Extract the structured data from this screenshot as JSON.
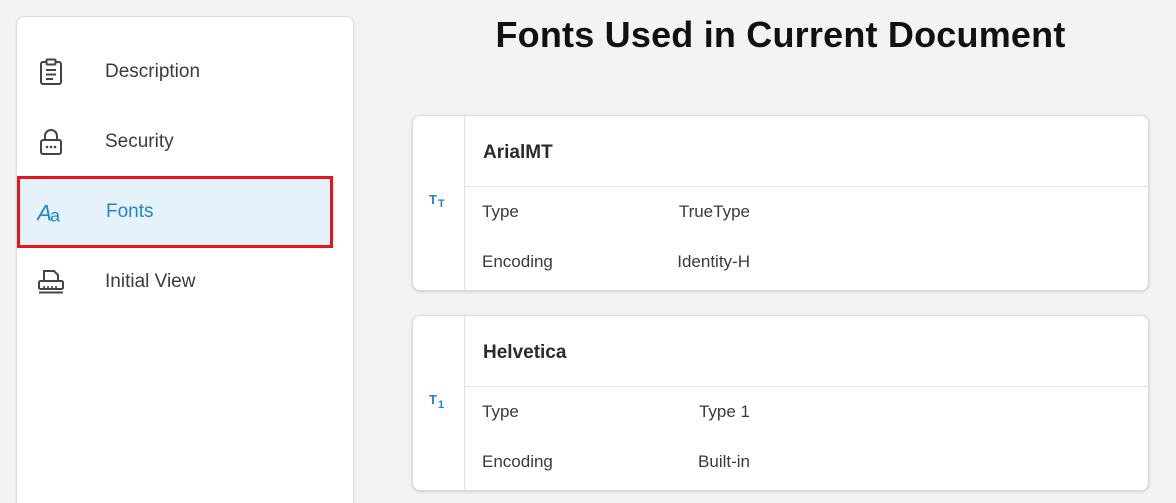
{
  "sidebar": {
    "items": [
      {
        "label": "Description",
        "icon": "clipboard-icon"
      },
      {
        "label": "Security",
        "icon": "lock-icon"
      },
      {
        "label": "Fonts",
        "icon": "font-icon",
        "active": true
      },
      {
        "label": "Initial View",
        "icon": "printer-icon"
      }
    ]
  },
  "main": {
    "title": "Fonts Used in Current Document",
    "fonts": [
      {
        "name": "ArialMT",
        "icon": "truetype-icon",
        "rows": [
          {
            "key": "Type",
            "value": "TrueType"
          },
          {
            "key": "Encoding",
            "value": "Identity-H"
          }
        ]
      },
      {
        "name": "Helvetica",
        "icon": "type1-icon",
        "rows": [
          {
            "key": "Type",
            "value": "Type 1"
          },
          {
            "key": "Encoding",
            "value": "Built-in"
          }
        ]
      }
    ]
  },
  "colors": {
    "accent": "#1b86d2",
    "highlight_border": "#e8141b",
    "active_bg": "#e6f2fb"
  }
}
